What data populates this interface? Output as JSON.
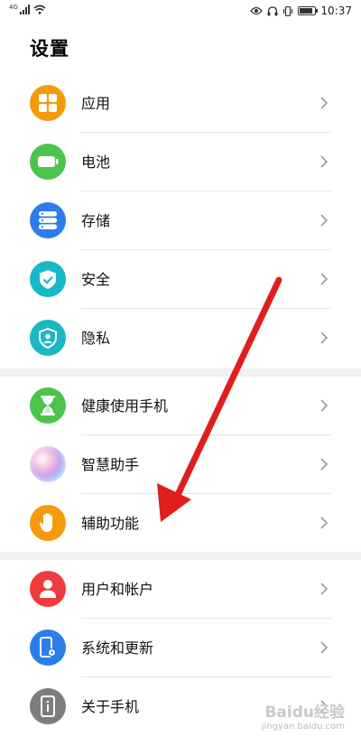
{
  "status_bar": {
    "network_badge": "4G",
    "time": "10:37",
    "battery_level": 0.9
  },
  "title": "设置",
  "sections": [
    {
      "items": [
        {
          "label": "应用",
          "icon": "apps-icon",
          "color": "#f59a0a"
        },
        {
          "label": "电池",
          "icon": "battery-icon",
          "color": "#4cc44c"
        },
        {
          "label": "存储",
          "icon": "storage-icon",
          "color": "#2b7de9"
        },
        {
          "label": "安全",
          "icon": "shield-check-icon",
          "color": "#19b8c6"
        },
        {
          "label": "隐私",
          "icon": "privacy-shield-icon",
          "color": "#19b8c6"
        }
      ]
    },
    {
      "items": [
        {
          "label": "健康使用手机",
          "icon": "hourglass-icon",
          "color": "#4cc44c"
        },
        {
          "label": "智慧助手",
          "icon": "assistant-orb-icon",
          "color": "#c9a6f0"
        },
        {
          "label": "辅助功能",
          "icon": "hand-icon",
          "color": "#f59a0a"
        }
      ]
    },
    {
      "items": [
        {
          "label": "用户和帐户",
          "icon": "user-icon",
          "color": "#ef3b3b"
        },
        {
          "label": "系统和更新",
          "icon": "phone-settings-icon",
          "color": "#2b7de9"
        },
        {
          "label": "关于手机",
          "icon": "phone-info-icon",
          "color": "#7d7d7d"
        }
      ]
    }
  ],
  "annotation_arrow_color": "#e01e1e",
  "watermark": {
    "main": "Baidu经验",
    "sub": "jingyan.baidu.com"
  }
}
